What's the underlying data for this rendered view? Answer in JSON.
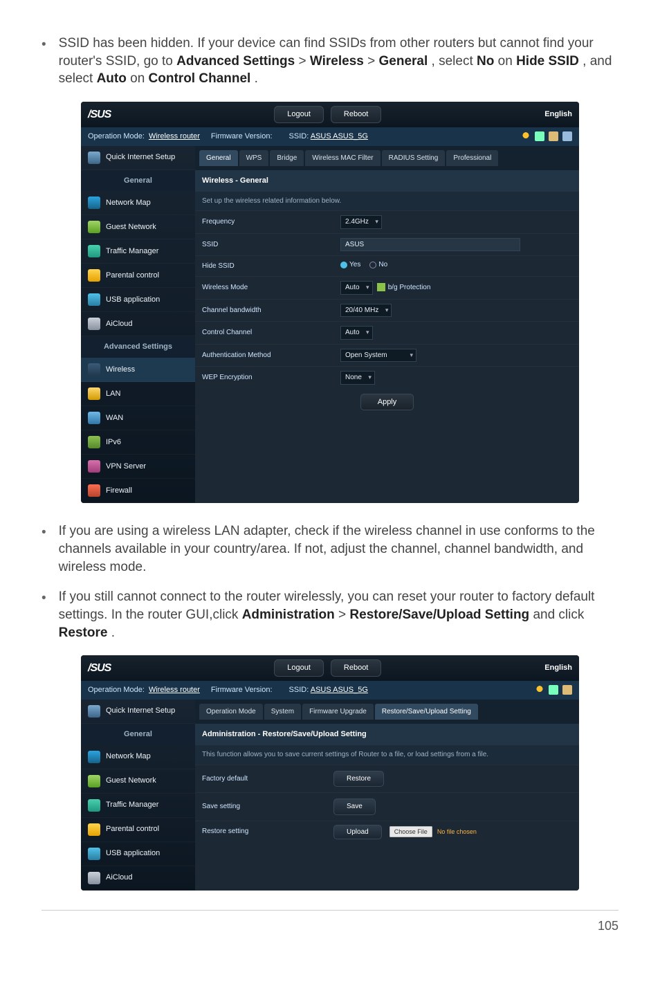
{
  "bullet1": {
    "pre": "SSID has been hidden. If your device can find SSIDs from other routers but cannot find your router's SSID, go to ",
    "b1": "Advanced Settings",
    "sep1": " > ",
    "b2": "Wireless",
    "sep2": " > ",
    "b3": "General",
    "mid1": ", select ",
    "b4": "No",
    "mid2": " on ",
    "b5": "Hide SSID",
    "mid3": ", and select ",
    "b6": "Auto",
    "mid4": " on ",
    "b7": "Control Channel",
    "end": "."
  },
  "shot1": {
    "logo": "/SUS",
    "logout": "Logout",
    "reboot": "Reboot",
    "english": "English",
    "op_mode_label": "Operation Mode:",
    "op_mode_value": "Wireless router",
    "fw_label": "Firmware Version:",
    "ssid_label": "SSID:",
    "ssid_value": "ASUS  ASUS_5G",
    "sidebar": {
      "qis": "Quick Internet Setup",
      "general": "General",
      "items_general": [
        "Network Map",
        "Guest Network",
        "Traffic Manager",
        "Parental control",
        "USB application",
        "AiCloud"
      ],
      "advanced": "Advanced Settings",
      "items_advanced": [
        "Wireless",
        "LAN",
        "WAN",
        "IPv6",
        "VPN Server",
        "Firewall"
      ]
    },
    "tabs": [
      "General",
      "WPS",
      "Bridge",
      "Wireless MAC Filter",
      "RADIUS Setting",
      "Professional"
    ],
    "panel_title": "Wireless - General",
    "panel_sub": "Set up the wireless related information below.",
    "rows": {
      "frequency_label": "Frequency",
      "frequency_value": "2.4GHz",
      "ssid_label": "SSID",
      "ssid_value": "ASUS",
      "hide_label": "Hide SSID",
      "hide_yes": "Yes",
      "hide_no": "No",
      "mode_label": "Wireless Mode",
      "mode_value": "Auto",
      "mode_chk": "b/g Protection",
      "bw_label": "Channel bandwidth",
      "bw_value": "20/40 MHz",
      "chan_label": "Control Channel",
      "chan_value": "Auto",
      "auth_label": "Authentication Method",
      "auth_value": "Open System",
      "wep_label": "WEP Encryption",
      "wep_value": "None"
    },
    "apply": "Apply"
  },
  "bullet2": "If you are using a wireless LAN adapter, check if the wireless channel in use conforms to the channels available in your country/area. If not, adjust the channel, channel bandwidth, and wireless mode.",
  "bullet3": {
    "pre": "If you still cannot connect to the router wirelessly, you can reset your router to factory default settings. In the router GUI,click ",
    "b1": "Administration",
    "sep": " > ",
    "b2": "Restore/Save/Upload Setting",
    "mid": " and click ",
    "b3": "Restore",
    "end": "."
  },
  "shot2": {
    "tabs": [
      "Operation Mode",
      "System",
      "Firmware Upgrade",
      "Restore/Save/Upload Setting"
    ],
    "panel_title": "Administration - Restore/Save/Upload Setting",
    "panel_sub": "This function allows you to save current settings of Router to a file, or load settings from a file.",
    "rows": {
      "factory_label": "Factory default",
      "factory_btn": "Restore",
      "save_label": "Save setting",
      "save_btn": "Save",
      "restore_label": "Restore setting",
      "restore_btn": "Upload",
      "choose": "Choose File",
      "nofile": "No file chosen"
    },
    "sidebar_items": [
      "Network Map",
      "Guest Network",
      "Traffic Manager",
      "Parental control",
      "USB application",
      "AiCloud"
    ]
  },
  "page_number": "105"
}
